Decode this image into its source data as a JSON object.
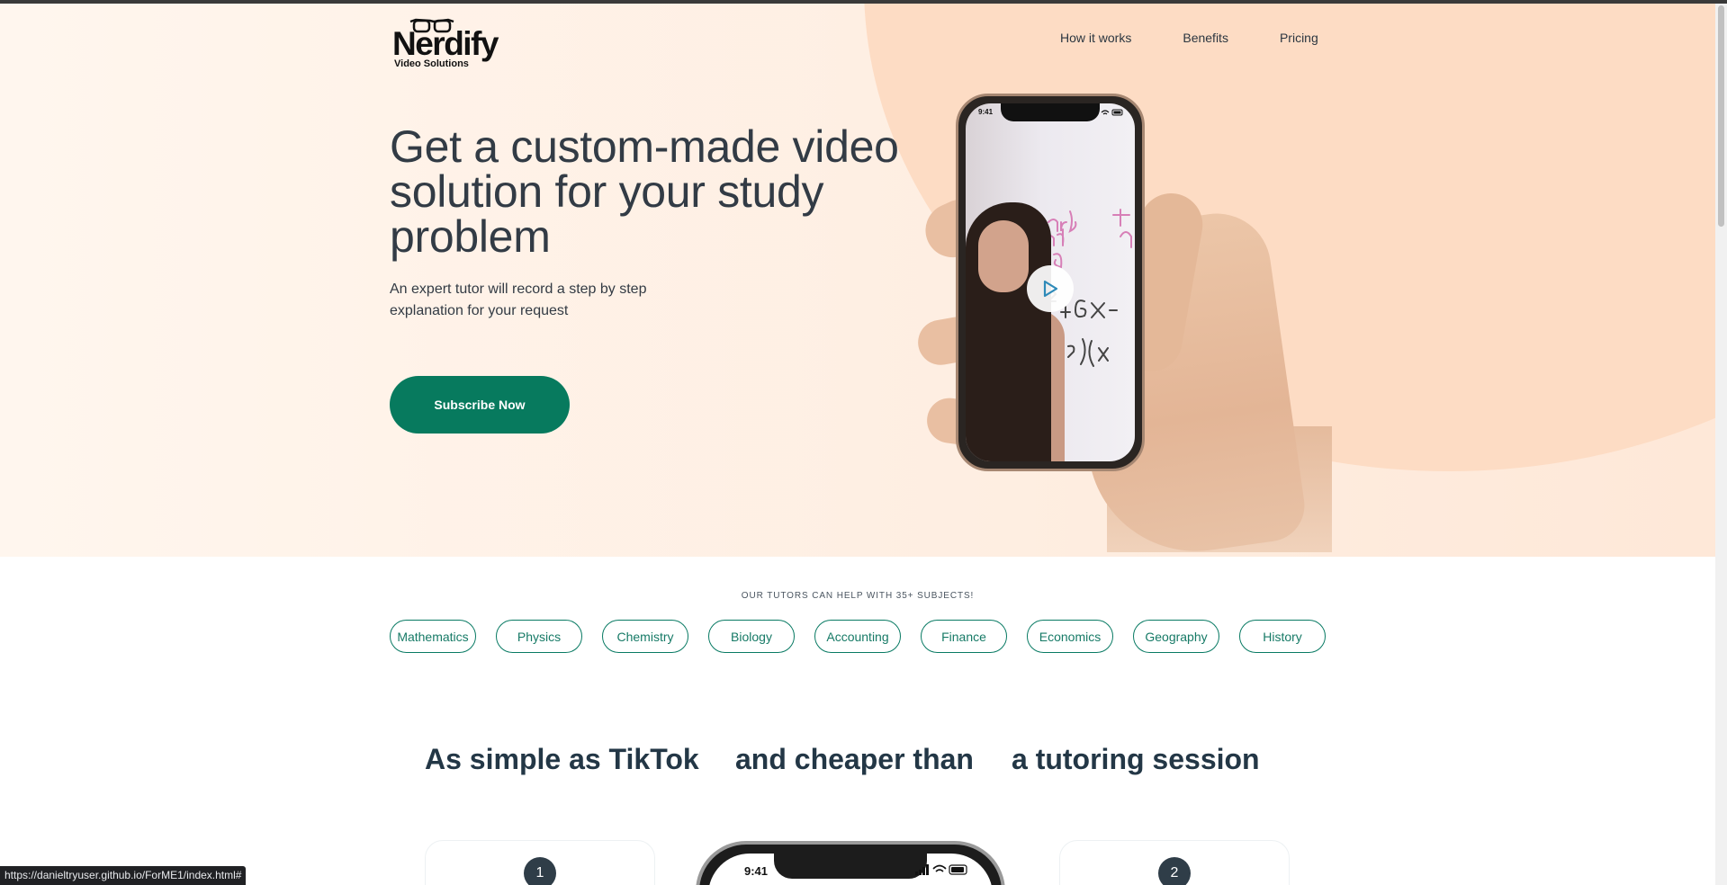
{
  "logo": {
    "name": "Nerdify",
    "tagline": "Video Solutions"
  },
  "nav": {
    "items": [
      {
        "label": "How it works"
      },
      {
        "label": "Benefits"
      },
      {
        "label": "Pricing"
      }
    ]
  },
  "hero": {
    "headline": "Get a custom-made video solution for your study problem",
    "subheadline": "An expert tutor will record a step by step explanation for your request",
    "cta_label": "Subscribe Now",
    "phone_time": "9:41",
    "play_icon": "play-icon"
  },
  "subjects": {
    "caption": "Our tutors can help with 35+ subjects!",
    "items": [
      "Mathematics",
      "Physics",
      "Chemistry",
      "Biology",
      "Accounting",
      "Finance",
      "Economics",
      "Geography",
      "History"
    ]
  },
  "slogans": [
    "As simple as TikTok",
    "and cheaper than",
    "a tutoring session"
  ],
  "steps": [
    {
      "number": "1"
    },
    {
      "number": "2"
    }
  ],
  "demo_phone": {
    "time": "9:41"
  },
  "status_url": "https://danieltryuser.github.io/ForME1/index.html#",
  "colors": {
    "accent": "#077a5e",
    "chip_border": "#087a63",
    "hero_bg": "#fee8d8",
    "heading": "#323b45"
  }
}
